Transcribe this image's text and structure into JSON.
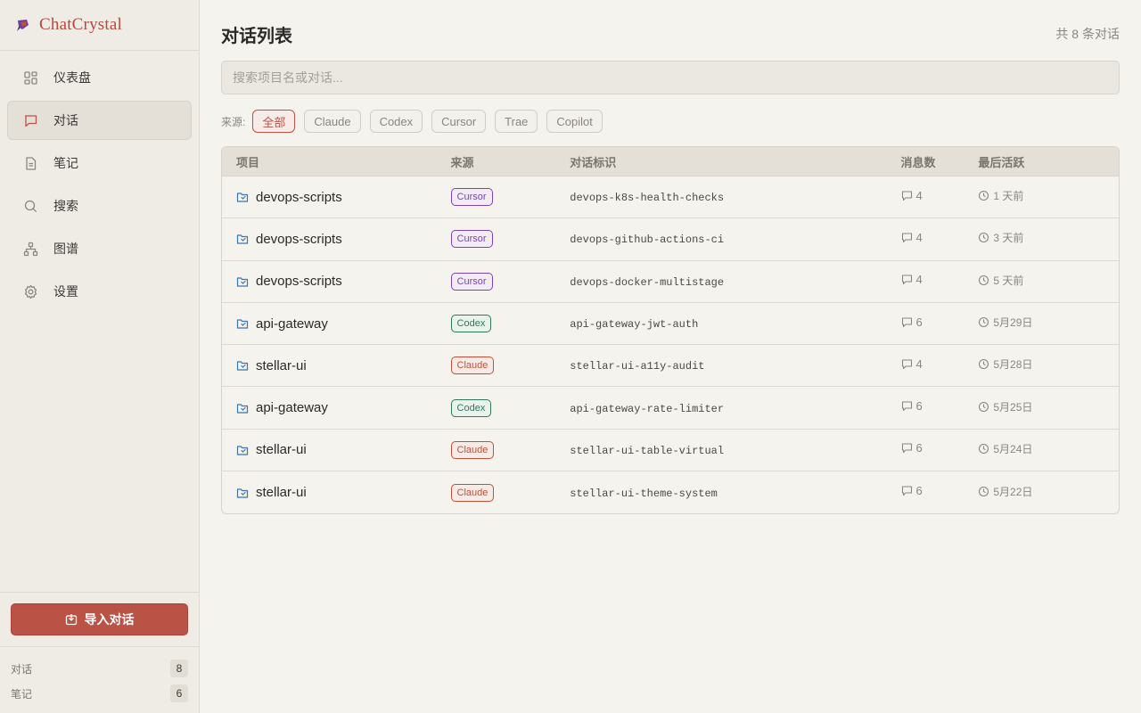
{
  "app": {
    "name": "ChatCrystal"
  },
  "nav": {
    "items": [
      {
        "label": "仪表盘",
        "icon": "dashboard-icon",
        "active": false
      },
      {
        "label": "对话",
        "icon": "chat-icon",
        "active": true
      },
      {
        "label": "笔记",
        "icon": "note-icon",
        "active": false
      },
      {
        "label": "搜索",
        "icon": "search-icon",
        "active": false
      },
      {
        "label": "图谱",
        "icon": "graph-icon",
        "active": false
      },
      {
        "label": "设置",
        "icon": "gear-icon",
        "active": false
      }
    ]
  },
  "sidebar_bottom": {
    "import_label": "导入对话",
    "stats": [
      {
        "label": "对话",
        "count": "8"
      },
      {
        "label": "笔记",
        "count": "6"
      }
    ]
  },
  "header": {
    "title": "对话列表",
    "total": "共 8 条对话"
  },
  "search": {
    "placeholder": "搜索项目名或对话..."
  },
  "filters": {
    "label": "来源:",
    "chips": [
      "全部",
      "Claude",
      "Codex",
      "Cursor",
      "Trae",
      "Copilot"
    ],
    "active": "全部"
  },
  "table": {
    "columns": [
      "项目",
      "来源",
      "对话标识",
      "消息数",
      "最后活跃"
    ],
    "rows": [
      {
        "project": "devops-scripts",
        "source": "Cursor",
        "id": "devops-k8s-health-checks",
        "messages": "4",
        "last_active": "1 天前"
      },
      {
        "project": "devops-scripts",
        "source": "Cursor",
        "id": "devops-github-actions-ci",
        "messages": "4",
        "last_active": "3 天前"
      },
      {
        "project": "devops-scripts",
        "source": "Cursor",
        "id": "devops-docker-multistage",
        "messages": "4",
        "last_active": "5 天前"
      },
      {
        "project": "api-gateway",
        "source": "Codex",
        "id": "api-gateway-jwt-auth",
        "messages": "6",
        "last_active": "5月29日"
      },
      {
        "project": "stellar-ui",
        "source": "Claude",
        "id": "stellar-ui-a11y-audit",
        "messages": "4",
        "last_active": "5月28日"
      },
      {
        "project": "api-gateway",
        "source": "Codex",
        "id": "api-gateway-rate-limiter",
        "messages": "6",
        "last_active": "5月25日"
      },
      {
        "project": "stellar-ui",
        "source": "Claude",
        "id": "stellar-ui-table-virtual",
        "messages": "6",
        "last_active": "5月24日"
      },
      {
        "project": "stellar-ui",
        "source": "Claude",
        "id": "stellar-ui-theme-system",
        "messages": "6",
        "last_active": "5月22日"
      }
    ]
  },
  "colors": {
    "accent": "#bb5246",
    "cursor": "#7b44b5",
    "codex": "#2f7a55",
    "claude": "#c0503d"
  }
}
